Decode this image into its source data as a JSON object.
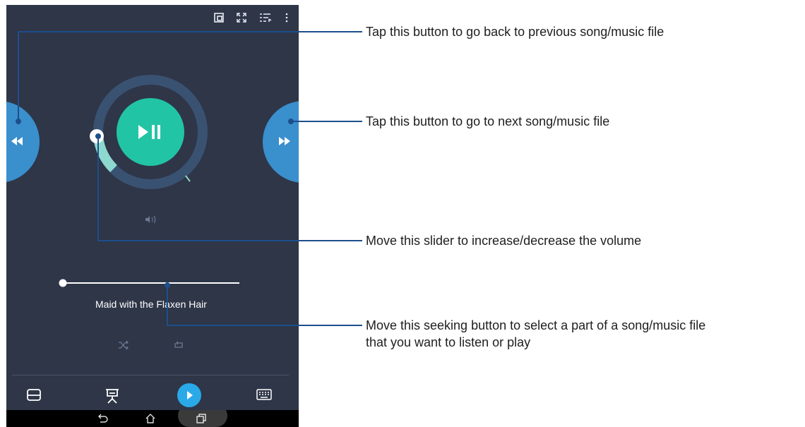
{
  "player": {
    "song_title": "Maid with the Flaxen Hair",
    "volume_level": 0.2,
    "seek_position": 0.0
  },
  "top_bar": {
    "icons": [
      "floating-window-icon",
      "fullscreen-icon",
      "playlist-icon",
      "more-options-icon"
    ]
  },
  "controls": {
    "prev_icon": "rewind-icon",
    "next_icon": "fast-forward-icon",
    "play_pause_icon": "play-pause-icon",
    "volume_icon": "speaker-icon",
    "shuffle_icon": "shuffle-icon",
    "repeat_icon": "repeat-icon"
  },
  "bottom_toolbar": {
    "icons": [
      "touchpad-icon",
      "presentation-icon",
      "play-icon",
      "keyboard-icon"
    ]
  },
  "system_nav": {
    "icons": [
      "back-icon",
      "home-icon",
      "recent-apps-icon"
    ]
  },
  "annotations": [
    {
      "text": "Tap this button to go back to previous song/music file"
    },
    {
      "text": "Tap this button to go to next song/music file"
    },
    {
      "text": "Move this slider to increase/decrease the volume"
    },
    {
      "line1": "Move this seeking button to select a part of a song/music file",
      "line2": "that you want to listen or play"
    }
  ],
  "colors": {
    "background": "#2e3648",
    "accent_teal": "#22c4a6",
    "blue": "#3a8fcd",
    "annotation_line": "#1d4f8c"
  }
}
